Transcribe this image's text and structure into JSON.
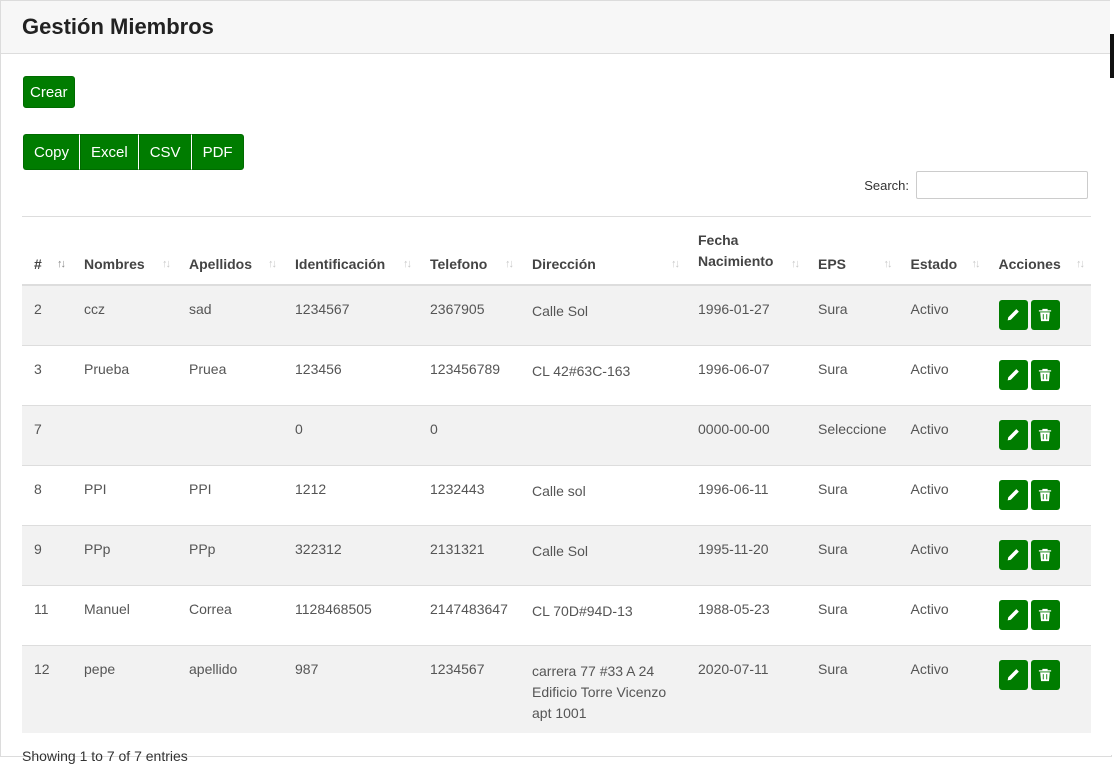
{
  "page": {
    "title": "Gestión Miembros"
  },
  "toolbar": {
    "crear_label": "Crear"
  },
  "export_buttons": [
    "Copy",
    "Excel",
    "CSV",
    "PDF"
  ],
  "search": {
    "label": "Search:",
    "value": ""
  },
  "table": {
    "columns": [
      "#",
      "Nombres",
      "Apellidos",
      "Identificación",
      "Telefono",
      "Dirección",
      "Fecha Nacimiento",
      "EPS",
      "Estado",
      "Acciones"
    ],
    "rows": [
      [
        "2",
        "ccz",
        "sad",
        "1234567",
        "2367905",
        "Calle Sol",
        "1996-01-27",
        "Sura",
        "Activo"
      ],
      [
        "3",
        "Prueba",
        "Pruea",
        "123456",
        "123456789",
        "CL 42#63C-163",
        "1996-06-07",
        "Sura",
        "Activo"
      ],
      [
        "7",
        "",
        "",
        "0",
        "0",
        "",
        "0000-00-00",
        "Seleccione",
        "Activo"
      ],
      [
        "8",
        "PPI",
        "PPI",
        "1212",
        "1232443",
        "Calle sol",
        "1996-06-11",
        "Sura",
        "Activo"
      ],
      [
        "9",
        "PPp",
        "PPp",
        "322312",
        "2131321",
        "Calle Sol",
        "1995-11-20",
        "Sura",
        "Activo"
      ],
      [
        "11",
        "Manuel",
        "Correa",
        "1128468505",
        "2147483647",
        "CL 70D#94D-13",
        "1988-05-23",
        "Sura",
        "Activo"
      ],
      [
        "12",
        "pepe",
        "apellido",
        "987",
        "1234567",
        "carrera 77 #33 A 24 Edificio Torre Vicenzo apt 1001",
        "2020-07-11",
        "Sura",
        "Activo"
      ]
    ],
    "actions": {
      "edit_icon": "pencil-icon",
      "delete_icon": "trash-icon"
    }
  },
  "footer": {
    "info_text": "Showing 1 to 7 of 7 entries"
  },
  "colors": {
    "primary": "#007c00",
    "stripe": "#f2f2f2",
    "header_bg": "#f7f7f7"
  }
}
